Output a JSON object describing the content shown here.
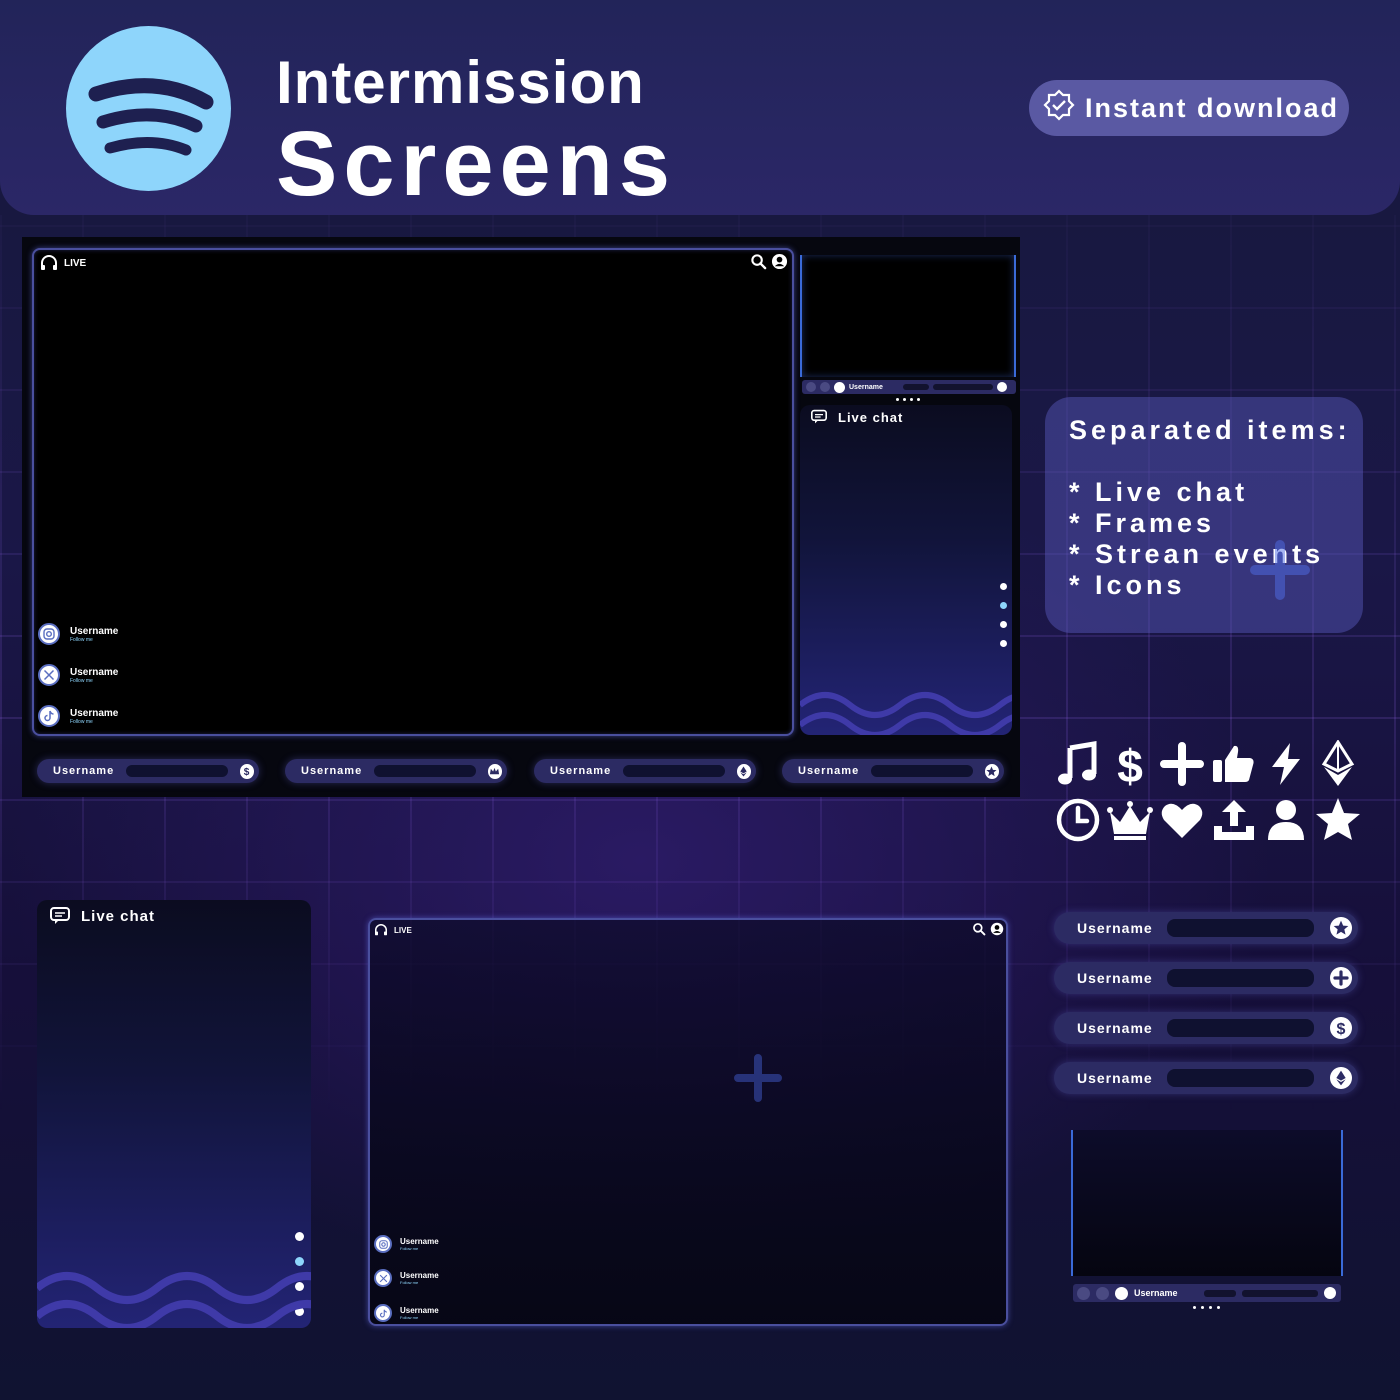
{
  "header": {
    "title_line1": "Intermission",
    "title_line2": "Screens",
    "logo_icon": "spotify-logo-icon",
    "download_label": "Instant download",
    "download_icon": "verified-badge-icon"
  },
  "overlay": {
    "live_label": "LIVE",
    "chat_title": "Live chat",
    "player_username": "Username",
    "socials": [
      {
        "platform_icon": "instagram-icon",
        "username": "Username",
        "subtitle": "Follow me"
      },
      {
        "platform_icon": "x-twitter-icon",
        "username": "Username",
        "subtitle": "Follow me"
      },
      {
        "platform_icon": "tiktok-icon",
        "username": "Username",
        "subtitle": "Follow me"
      }
    ],
    "bottom_alerts": [
      {
        "username": "Username",
        "icon": "dollar-icon"
      },
      {
        "username": "Username",
        "icon": "crown-icon"
      },
      {
        "username": "Username",
        "icon": "ethereum-icon"
      },
      {
        "username": "Username",
        "icon": "star-icon"
      }
    ]
  },
  "separated": {
    "title": "Separated items:",
    "items": [
      "Live chat",
      "Frames",
      "Strean events",
      "Icons"
    ]
  },
  "icons": [
    "music-note-icon",
    "dollar-icon",
    "plus-icon",
    "thumbs-up-icon",
    "lightning-icon",
    "ethereum-icon",
    "clock-icon",
    "crown-icon",
    "heart-icon",
    "upload-icon",
    "user-icon",
    "star-icon"
  ],
  "side_alerts": [
    {
      "username": "Username",
      "icon": "star-icon"
    },
    {
      "username": "Username",
      "icon": "plus-icon"
    },
    {
      "username": "Username",
      "icon": "dollar-icon"
    },
    {
      "username": "Username",
      "icon": "ethereum-icon"
    }
  ],
  "small_chat": {
    "title": "Live chat"
  },
  "small_frame": {
    "live_label": "LIVE"
  },
  "colors": {
    "accent": "#8ed5fb",
    "panel": "#2c2b63",
    "frame_border": "#4a4f9e"
  }
}
